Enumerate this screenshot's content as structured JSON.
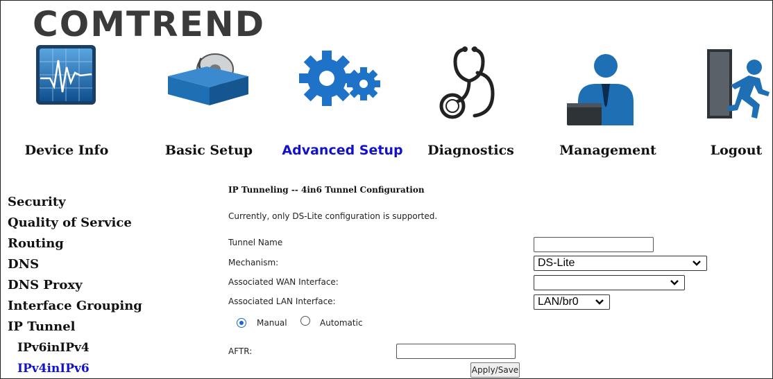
{
  "brand": {
    "logo_text": "COMTREND"
  },
  "nav": {
    "items": [
      {
        "label": "Device Info",
        "icon": "device-info-icon"
      },
      {
        "label": "Basic Setup",
        "icon": "basic-setup-icon"
      },
      {
        "label": "Advanced Setup",
        "icon": "advanced-setup-icon"
      },
      {
        "label": "Diagnostics",
        "icon": "diagnostics-icon"
      },
      {
        "label": "Management",
        "icon": "management-icon"
      },
      {
        "label": "Logout",
        "icon": "logout-icon"
      }
    ],
    "active": "Advanced Setup"
  },
  "sidebar": {
    "items": [
      {
        "label": "Security"
      },
      {
        "label": "Quality of Service"
      },
      {
        "label": "Routing"
      },
      {
        "label": "DNS"
      },
      {
        "label": "DNS Proxy"
      },
      {
        "label": "Interface Grouping"
      },
      {
        "label": "IP Tunnel"
      },
      {
        "label": "IPv6inIPv4"
      },
      {
        "label": "IPv4inIPv6"
      }
    ],
    "active": "IPv4inIPv6"
  },
  "form": {
    "title": "IP Tunneling -- 4in6 Tunnel Configuration",
    "note": "Currently, only DS-Lite configuration is supported.",
    "tunnel_name_label": "Tunnel Name",
    "tunnel_name_value": "",
    "mechanism_label": "Mechanism:",
    "mechanism_value": "DS-Lite",
    "wan_label": "Associated WAN Interface:",
    "wan_value": "",
    "lan_label": "Associated LAN Interface:",
    "lan_value": "LAN/br0",
    "mode_options": [
      {
        "label": "Manual",
        "selected": true
      },
      {
        "label": "Automatic",
        "selected": false
      }
    ],
    "aftr_label": "AFTR:",
    "aftr_value": "",
    "apply_label": "Apply/Save"
  },
  "colors": {
    "active_link": "#1212cc",
    "icon_blue": "#1f6fb4",
    "icon_dark": "#2e3338"
  }
}
